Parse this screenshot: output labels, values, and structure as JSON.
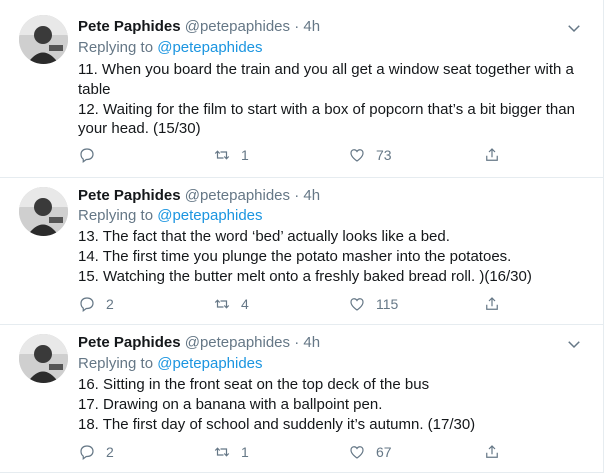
{
  "tweets": [
    {
      "name": "Pete Paphides",
      "handle": "@petepaphides",
      "dot": "·",
      "time": "4h",
      "replying_prefix": "Replying to ",
      "replying_to": "@petepaphides",
      "lines": [
        "11. When you board the train and you all get a window seat together with a table",
        "12. Waiting for the film to start with a box of popcorn that’s a bit bigger than your head. (15/30)"
      ],
      "reply_count": "",
      "retweet_count": "1",
      "like_count": "73"
    },
    {
      "name": "Pete Paphides",
      "handle": "@petepaphides",
      "dot": "·",
      "time": "4h",
      "replying_prefix": "Replying to ",
      "replying_to": "@petepaphides",
      "lines": [
        "13. The fact that the word ‘bed’ actually looks like a bed.",
        "14. The first time you plunge the potato masher into the potatoes.",
        "15. Watching the butter melt onto a freshly baked bread roll. )(16/30)"
      ],
      "reply_count": "2",
      "retweet_count": "4",
      "like_count": "115"
    },
    {
      "name": "Pete Paphides",
      "handle": "@petepaphides",
      "dot": "·",
      "time": "4h",
      "replying_prefix": "Replying to ",
      "replying_to": "@petepaphides",
      "lines": [
        "16. Sitting in the front seat on the top deck of the bus",
        "17. Drawing on a banana with a ballpoint pen.",
        "18. The first day of school and suddenly it’s autumn. (17/30)"
      ],
      "reply_count": "2",
      "retweet_count": "1",
      "like_count": "67"
    }
  ],
  "colors": {
    "link": "#1b95e0",
    "muted": "#657786",
    "text": "#14171a",
    "border": "#e6ecf0"
  },
  "icons": [
    "chevron-down-icon",
    "reply-icon",
    "retweet-icon",
    "like-icon",
    "share-icon"
  ]
}
